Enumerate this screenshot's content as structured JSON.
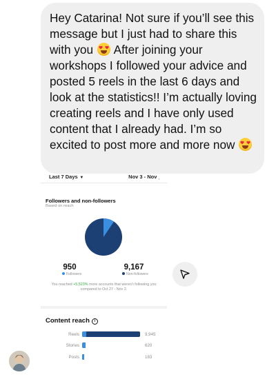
{
  "message": {
    "part1": "Hey Catarina! Not sure if you’ll see this message but I just had to share this with you",
    "part2": "After joining your workshops I followed your advice and posted 5 reels in the last 6 days and look at the statistics!! I’m actually loving creating reels and I have only used content that I already had. I’m so excited to post more and more now",
    "emoji_icon": "heart-eyes-emoji-icon"
  },
  "insights": {
    "range_label": "Last 7 Days",
    "date_range": "Nov 3 - Nov ˌ",
    "followers_section": {
      "title": "Followers and non-followers",
      "subtitle": "Based on reach",
      "followers_count": "950",
      "followers_label": "Followers",
      "non_followers_count": "9,167",
      "non_followers_label": "Non-followers",
      "note_prefix": "You reached ",
      "note_pct": "+5,523%",
      "note_suffix": " more accounts that weren’t following you compared to Oct 27 - Nov 2.",
      "followers_share": 0.094,
      "colors": {
        "followers": "#3b8fe0",
        "non_followers": "#1c3f74",
        "increase": "#3aa542"
      }
    },
    "content_reach": {
      "title": "Content reach",
      "info_icon": "i",
      "rows": [
        {
          "label": "Reels",
          "value": "9,945",
          "amount": 9945
        },
        {
          "label": "Stories",
          "value": "620",
          "amount": 620
        },
        {
          "label": "Posts",
          "value": "183",
          "amount": 183
        }
      ]
    }
  },
  "send_icon": "send-icon",
  "avatar_icon": "profile-avatar"
}
